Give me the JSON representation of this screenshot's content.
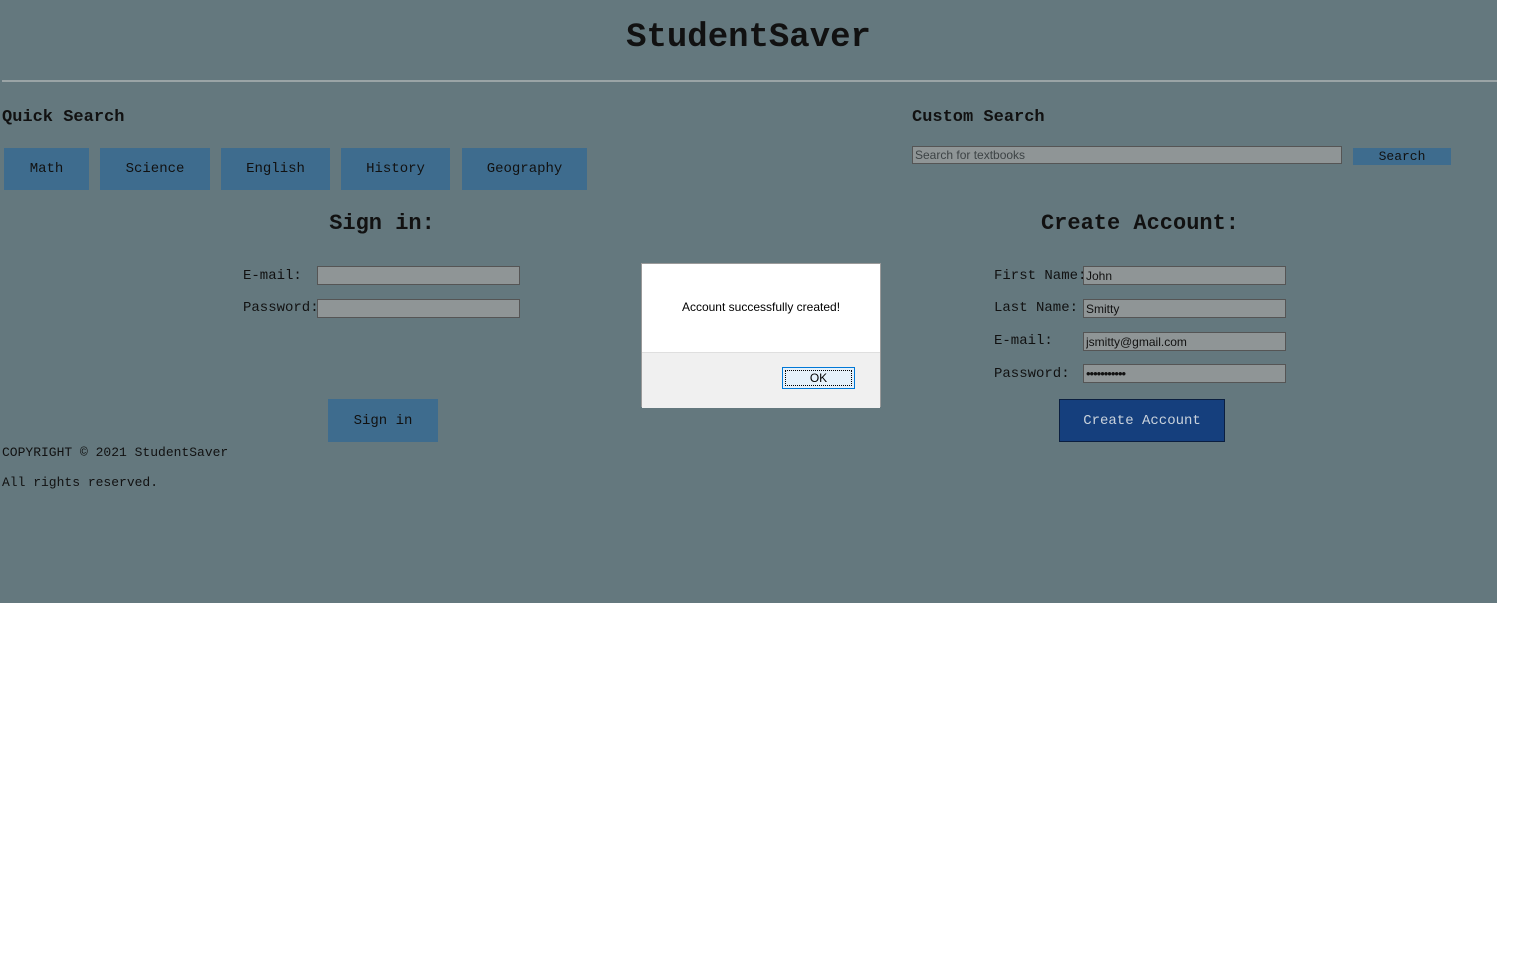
{
  "site": {
    "title": "StudentSaver"
  },
  "quick_search": {
    "heading": "Quick Search",
    "buttons": [
      "Math",
      "Science",
      "English",
      "History",
      "Geography"
    ]
  },
  "custom_search": {
    "heading": "Custom Search",
    "placeholder": "Search for textbooks",
    "value": "",
    "button_label": "Search"
  },
  "sign_in": {
    "title": "Sign in:",
    "email_label": "E-mail:",
    "password_label": "Password:",
    "email_value": "",
    "password_value": "",
    "button_label": "Sign in"
  },
  "create_account": {
    "title": "Create Account:",
    "first_name_label": "First Name:",
    "last_name_label": "Last Name:",
    "email_label": "E-mail:",
    "password_label": "Password:",
    "first_name_value": "John",
    "last_name_value": "Smitty",
    "email_value": "jsmitty@gmail.com",
    "password_value": "•••••••••••",
    "button_label": "Create Account"
  },
  "footer": {
    "copyright": "COPYRIGHT © 2021 StudentSaver",
    "rights": "All rights reserved."
  },
  "dialog": {
    "message": "Account successfully created!",
    "ok_label": "OK"
  },
  "colors": {
    "page_background": "#64787e",
    "button_background": "#3e6c8e",
    "create_button_background": "#153f7d",
    "input_background": "#8f9596"
  }
}
